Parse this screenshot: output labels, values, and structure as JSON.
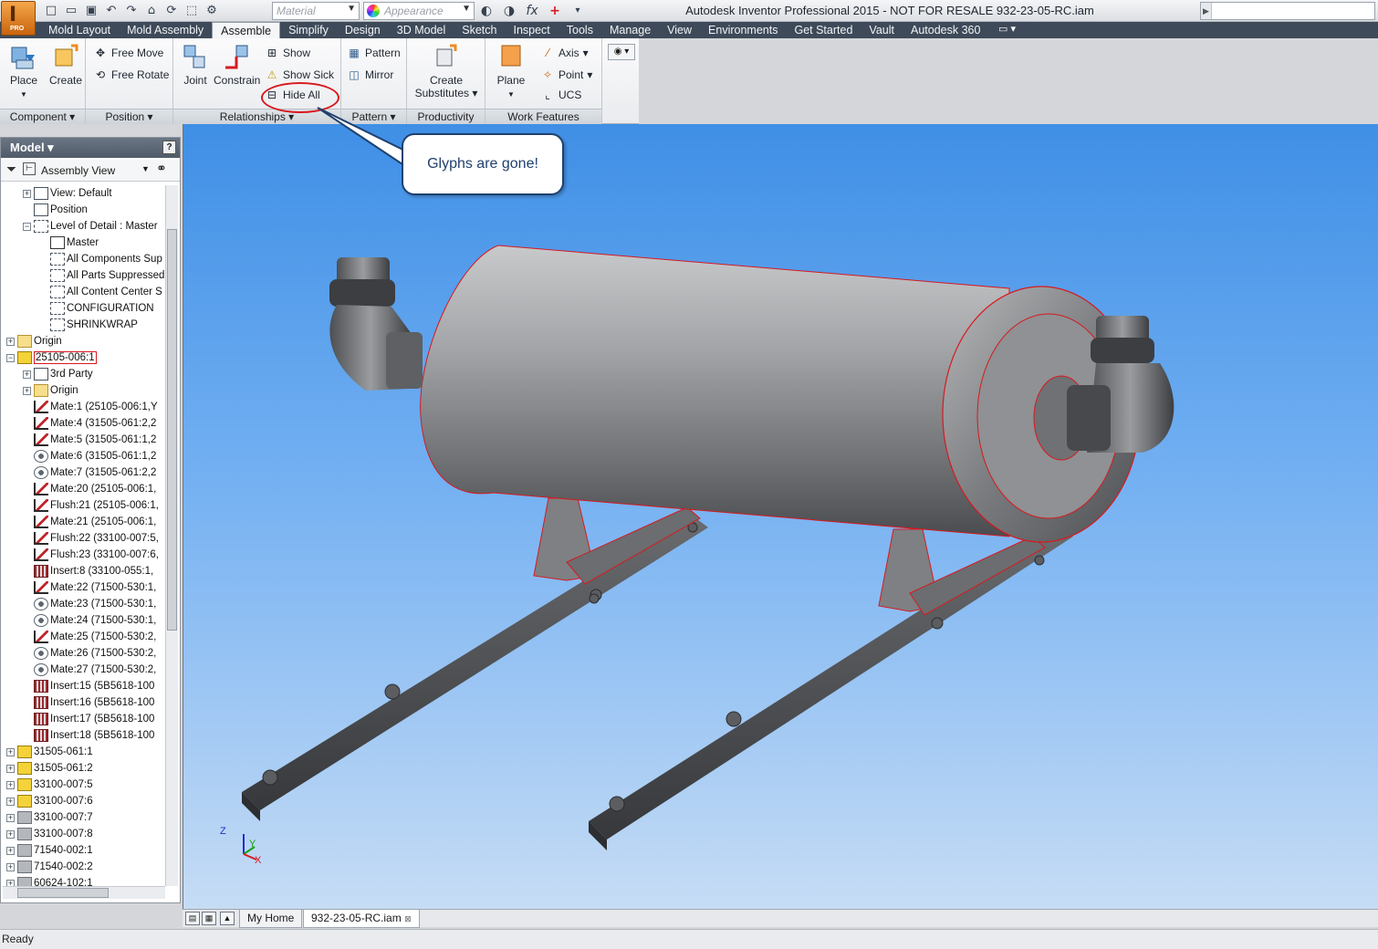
{
  "window": {
    "title": "Autodesk Inventor Professional 2015 - NOT FOR RESALE    932-23-05-RC.iam",
    "app_badge": "PRO",
    "material_placeholder": "Material",
    "appearance_placeholder": "Appearance"
  },
  "tabs": [
    "Mold Layout",
    "Mold Assembly",
    "Assemble",
    "Simplify",
    "Design",
    "3D Model",
    "Sketch",
    "Inspect",
    "Tools",
    "Manage",
    "View",
    "Environments",
    "Get Started",
    "Vault",
    "Autodesk 360"
  ],
  "active_tab": "Assemble",
  "ribbon": {
    "component": {
      "title": "Component",
      "place": "Place",
      "create": "Create"
    },
    "position": {
      "title": "Position",
      "free_move": "Free Move",
      "free_rotate": "Free Rotate"
    },
    "relationships": {
      "title": "Relationships",
      "joint": "Joint",
      "constrain": "Constrain",
      "show": "Show",
      "show_sick": "Show Sick",
      "hide_all": "Hide All"
    },
    "pattern": {
      "title": "Pattern",
      "pattern": "Pattern",
      "mirror": "Mirror"
    },
    "productivity": {
      "title": "Productivity",
      "create_line1": "Create",
      "create_line2": "Substitutes"
    },
    "work_features": {
      "title": "Work Features",
      "plane": "Plane",
      "axis": "Axis",
      "point": "Point",
      "ucs": "UCS"
    }
  },
  "browser": {
    "title": "Model",
    "view_mode": "Assembly View",
    "tree": [
      {
        "label": "View: Default",
        "icon": "view",
        "level": 1,
        "expander": "+"
      },
      {
        "label": "Position",
        "icon": "view",
        "level": 1,
        "expander": ""
      },
      {
        "label": "Level of Detail : Master",
        "icon": "lod",
        "level": 1,
        "expander": "-"
      },
      {
        "label": "Master",
        "icon": "check",
        "level": 2,
        "expander": ""
      },
      {
        "label": "All Components Sup",
        "icon": "lod",
        "level": 2,
        "expander": ""
      },
      {
        "label": "All Parts Suppressed",
        "icon": "lod",
        "level": 2,
        "expander": ""
      },
      {
        "label": "All Content Center S",
        "icon": "lod",
        "level": 2,
        "expander": ""
      },
      {
        "label": "CONFIGURATION",
        "icon": "lod",
        "level": 2,
        "expander": ""
      },
      {
        "label": "SHRINKWRAP",
        "icon": "lod",
        "level": 2,
        "expander": ""
      },
      {
        "label": "Origin",
        "icon": "folder",
        "level": 0,
        "expander": "+"
      },
      {
        "label": "25105-006:1",
        "icon": "part",
        "level": 0,
        "expander": "-",
        "selected": true
      },
      {
        "label": "3rd Party",
        "icon": "view",
        "level": 1,
        "expander": "+"
      },
      {
        "label": "Origin",
        "icon": "folder",
        "level": 1,
        "expander": "+"
      },
      {
        "label": "Mate:1 (25105-006:1,Y",
        "icon": "mate",
        "level": 1,
        "expander": ""
      },
      {
        "label": "Mate:4 (31505-061:2,2",
        "icon": "mate",
        "level": 1,
        "expander": ""
      },
      {
        "label": "Mate:5 (31505-061:1,2",
        "icon": "mate",
        "level": 1,
        "expander": ""
      },
      {
        "label": "Mate:6 (31505-061:1,2",
        "icon": "ang",
        "level": 1,
        "expander": ""
      },
      {
        "label": "Mate:7 (31505-061:2,2",
        "icon": "ang",
        "level": 1,
        "expander": ""
      },
      {
        "label": "Mate:20 (25105-006:1,",
        "icon": "mate",
        "level": 1,
        "expander": ""
      },
      {
        "label": "Flush:21 (25105-006:1,",
        "icon": "mate",
        "level": 1,
        "expander": ""
      },
      {
        "label": "Mate:21 (25105-006:1,",
        "icon": "mate",
        "level": 1,
        "expander": ""
      },
      {
        "label": "Flush:22 (33100-007:5,",
        "icon": "mate",
        "level": 1,
        "expander": ""
      },
      {
        "label": "Flush:23 (33100-007:6,",
        "icon": "mate",
        "level": 1,
        "expander": ""
      },
      {
        "label": "Insert:8 (33100-055:1,",
        "icon": "ins",
        "level": 1,
        "expander": ""
      },
      {
        "label": "Mate:22 (71500-530:1,",
        "icon": "mate",
        "level": 1,
        "expander": ""
      },
      {
        "label": "Mate:23 (71500-530:1,",
        "icon": "ang",
        "level": 1,
        "expander": ""
      },
      {
        "label": "Mate:24 (71500-530:1,",
        "icon": "ang",
        "level": 1,
        "expander": ""
      },
      {
        "label": "Mate:25 (71500-530:2,",
        "icon": "mate",
        "level": 1,
        "expander": ""
      },
      {
        "label": "Mate:26 (71500-530:2,",
        "icon": "ang",
        "level": 1,
        "expander": ""
      },
      {
        "label": "Mate:27 (71500-530:2,",
        "icon": "ang",
        "level": 1,
        "expander": ""
      },
      {
        "label": "Insert:15 (5B5618-100",
        "icon": "ins",
        "level": 1,
        "expander": ""
      },
      {
        "label": "Insert:16 (5B5618-100",
        "icon": "ins",
        "level": 1,
        "expander": ""
      },
      {
        "label": "Insert:17 (5B5618-100",
        "icon": "ins",
        "level": 1,
        "expander": ""
      },
      {
        "label": "Insert:18 (5B5618-100",
        "icon": "ins",
        "level": 1,
        "expander": ""
      },
      {
        "label": "31505-061:1",
        "icon": "part",
        "level": 0,
        "expander": "+"
      },
      {
        "label": "31505-061:2",
        "icon": "part",
        "level": 0,
        "expander": "+"
      },
      {
        "label": "33100-007:5",
        "icon": "part",
        "level": 0,
        "expander": "+"
      },
      {
        "label": "33100-007:6",
        "icon": "part",
        "level": 0,
        "expander": "+"
      },
      {
        "label": "33100-007:7",
        "icon": "grey",
        "level": 0,
        "expander": "+"
      },
      {
        "label": "33100-007:8",
        "icon": "grey",
        "level": 0,
        "expander": "+"
      },
      {
        "label": "71540-002:1",
        "icon": "grey",
        "level": 0,
        "expander": "+"
      },
      {
        "label": "71540-002:2",
        "icon": "grey",
        "level": 0,
        "expander": "+"
      },
      {
        "label": "60624-102:1",
        "icon": "grey",
        "level": 0,
        "expander": "+"
      }
    ]
  },
  "callout": {
    "text": "Glyphs are gone!"
  },
  "viewcube": {
    "x": "X",
    "y": "Y",
    "z": "Z"
  },
  "doc_tabs": {
    "home": "My Home",
    "active": "932-23-05-RC.iam"
  },
  "status": {
    "text": "Ready"
  },
  "colors": {
    "tab_bar": "#3e4a59",
    "viewport_top": "#3f8fe6",
    "viewport_bottom": "#c6dcf5",
    "highlight": "#d7191e",
    "callout_border": "#20416e"
  }
}
